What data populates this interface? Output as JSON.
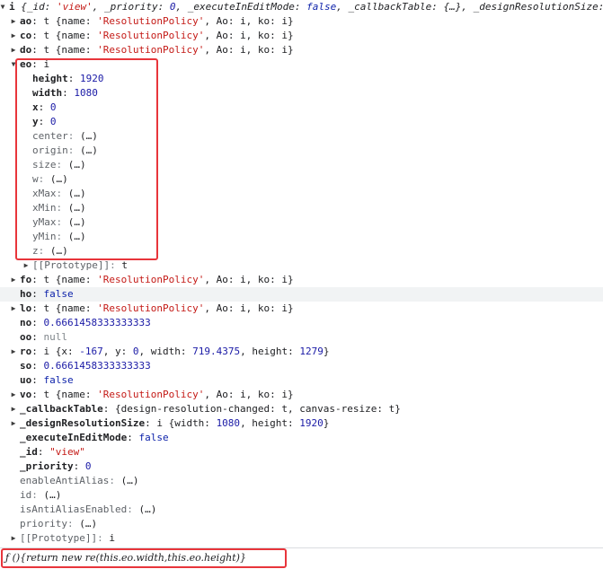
{
  "rows": [
    {
      "indent": 1,
      "arrow": "▾",
      "key": "i",
      "style": "bold",
      "rest": [
        {
          "t": "{_id: ",
          "c": "it"
        },
        {
          "t": "'view'",
          "c": "str it"
        },
        {
          "t": ", _priority: ",
          "c": "it"
        },
        {
          "t": "0",
          "c": "num it"
        },
        {
          "t": ", _executeInEditMode: ",
          "c": "it"
        },
        {
          "t": "false",
          "c": "bool it"
        },
        {
          "t": ", _callbackTable: {…}, _designResolutionSize: i, …}",
          "c": "it"
        }
      ],
      "raw_key_sep": " "
    },
    {
      "indent": 2,
      "arrow": "▸",
      "key": "ao",
      "style": "bold",
      "rest": [
        {
          "t": "t  {name: ",
          "c": ""
        },
        {
          "t": "'ResolutionPolicy'",
          "c": "str"
        },
        {
          "t": ", Ao: i, ko: i}",
          "c": ""
        }
      ]
    },
    {
      "indent": 2,
      "arrow": "▸",
      "key": "co",
      "style": "bold",
      "rest": [
        {
          "t": "t  {name: ",
          "c": ""
        },
        {
          "t": "'ResolutionPolicy'",
          "c": "str"
        },
        {
          "t": ", Ao: i, ko: i}",
          "c": ""
        }
      ]
    },
    {
      "indent": 2,
      "arrow": "▸",
      "key": "do",
      "style": "bold",
      "rest": [
        {
          "t": "t  {name: ",
          "c": ""
        },
        {
          "t": "'ResolutionPolicy'",
          "c": "str"
        },
        {
          "t": ", Ao: i, ko: i}",
          "c": ""
        }
      ]
    },
    {
      "indent": 2,
      "arrow": "▾",
      "key": "eo",
      "style": "bold",
      "rest": [
        {
          "t": "i",
          "c": ""
        }
      ]
    },
    {
      "indent": 3,
      "arrow": "",
      "key": "height",
      "style": "bold",
      "rest": [
        {
          "t": "1920",
          "c": "num"
        }
      ]
    },
    {
      "indent": 3,
      "arrow": "",
      "key": "width",
      "style": "bold",
      "rest": [
        {
          "t": "1080",
          "c": "num"
        }
      ]
    },
    {
      "indent": 3,
      "arrow": "",
      "key": "x",
      "style": "bold",
      "rest": [
        {
          "t": "0",
          "c": "num"
        }
      ]
    },
    {
      "indent": 3,
      "arrow": "",
      "key": "y",
      "style": "bold",
      "rest": [
        {
          "t": "0",
          "c": "num"
        }
      ]
    },
    {
      "indent": 3,
      "arrow": "",
      "key": "center",
      "style": "dim",
      "rest": [
        {
          "t": "(…)",
          "c": ""
        }
      ]
    },
    {
      "indent": 3,
      "arrow": "",
      "key": "origin",
      "style": "dim",
      "rest": [
        {
          "t": "(…)",
          "c": ""
        }
      ]
    },
    {
      "indent": 3,
      "arrow": "",
      "key": "size",
      "style": "dim",
      "rest": [
        {
          "t": "(…)",
          "c": ""
        }
      ]
    },
    {
      "indent": 3,
      "arrow": "",
      "key": "w",
      "style": "dim",
      "rest": [
        {
          "t": "(…)",
          "c": ""
        }
      ]
    },
    {
      "indent": 3,
      "arrow": "",
      "key": "xMax",
      "style": "dim",
      "rest": [
        {
          "t": "(…)",
          "c": ""
        }
      ]
    },
    {
      "indent": 3,
      "arrow": "",
      "key": "xMin",
      "style": "dim",
      "rest": [
        {
          "t": "(…)",
          "c": ""
        }
      ]
    },
    {
      "indent": 3,
      "arrow": "",
      "key": "yMax",
      "style": "dim",
      "rest": [
        {
          "t": "(…)",
          "c": ""
        }
      ]
    },
    {
      "indent": 3,
      "arrow": "",
      "key": "yMin",
      "style": "dim",
      "rest": [
        {
          "t": "(…)",
          "c": ""
        }
      ]
    },
    {
      "indent": 3,
      "arrow": "",
      "key": "z",
      "style": "dim",
      "rest": [
        {
          "t": "(…)",
          "c": ""
        }
      ]
    },
    {
      "indent": 3,
      "arrow": "▸",
      "key": "[[Prototype]]",
      "style": "dim",
      "rest": [
        {
          "t": "t",
          "c": ""
        }
      ]
    },
    {
      "indent": 2,
      "arrow": "▸",
      "key": "fo",
      "style": "bold",
      "rest": [
        {
          "t": "t  {name: ",
          "c": ""
        },
        {
          "t": "'ResolutionPolicy'",
          "c": "str"
        },
        {
          "t": ", Ao: i, ko: i}",
          "c": ""
        }
      ]
    },
    {
      "indent": 2,
      "arrow": "",
      "key": "ho",
      "style": "bold",
      "rest": [
        {
          "t": "false",
          "c": "bool"
        }
      ],
      "highlight": true
    },
    {
      "indent": 2,
      "arrow": "▸",
      "key": "lo",
      "style": "bold",
      "rest": [
        {
          "t": "t  {name: ",
          "c": ""
        },
        {
          "t": "'ResolutionPolicy'",
          "c": "str"
        },
        {
          "t": ", Ao: i, ko: i}",
          "c": ""
        }
      ]
    },
    {
      "indent": 2,
      "arrow": "",
      "key": "no",
      "style": "bold",
      "rest": [
        {
          "t": "0.6661458333333333",
          "c": "num"
        }
      ]
    },
    {
      "indent": 2,
      "arrow": "",
      "key": "oo",
      "style": "bold",
      "rest": [
        {
          "t": "null",
          "c": "nul"
        }
      ]
    },
    {
      "indent": 2,
      "arrow": "▸",
      "key": "ro",
      "style": "bold",
      "rest": [
        {
          "t": "i  {x: ",
          "c": ""
        },
        {
          "t": "-167",
          "c": "num"
        },
        {
          "t": ", y: ",
          "c": ""
        },
        {
          "t": "0",
          "c": "num"
        },
        {
          "t": ", width: ",
          "c": ""
        },
        {
          "t": "719.4375",
          "c": "num"
        },
        {
          "t": ", height: ",
          "c": ""
        },
        {
          "t": "1279",
          "c": "num"
        },
        {
          "t": "}",
          "c": ""
        }
      ]
    },
    {
      "indent": 2,
      "arrow": "",
      "key": "so",
      "style": "bold",
      "rest": [
        {
          "t": "0.6661458333333333",
          "c": "num"
        }
      ]
    },
    {
      "indent": 2,
      "arrow": "",
      "key": "uo",
      "style": "bold",
      "rest": [
        {
          "t": "false",
          "c": "bool"
        }
      ]
    },
    {
      "indent": 2,
      "arrow": "▸",
      "key": "vo",
      "style": "bold",
      "rest": [
        {
          "t": "t  {name: ",
          "c": ""
        },
        {
          "t": "'ResolutionPolicy'",
          "c": "str"
        },
        {
          "t": ", Ao: i, ko: i}",
          "c": ""
        }
      ]
    },
    {
      "indent": 2,
      "arrow": "▸",
      "key": "_callbackTable",
      "style": "bold",
      "rest": [
        {
          "t": "{design-resolution-changed: t, canvas-resize: t}",
          "c": ""
        }
      ]
    },
    {
      "indent": 2,
      "arrow": "▸",
      "key": "_designResolutionSize",
      "style": "bold",
      "rest": [
        {
          "t": "i  {width: ",
          "c": ""
        },
        {
          "t": "1080",
          "c": "num"
        },
        {
          "t": ", height: ",
          "c": ""
        },
        {
          "t": "1920",
          "c": "num"
        },
        {
          "t": "}",
          "c": ""
        }
      ]
    },
    {
      "indent": 2,
      "arrow": "",
      "key": "_executeInEditMode",
      "style": "bold",
      "rest": [
        {
          "t": "false",
          "c": "bool"
        }
      ]
    },
    {
      "indent": 2,
      "arrow": "",
      "key": "_id",
      "style": "bold",
      "rest": [
        {
          "t": "\"view\"",
          "c": "str"
        }
      ]
    },
    {
      "indent": 2,
      "arrow": "",
      "key": "_priority",
      "style": "bold",
      "rest": [
        {
          "t": "0",
          "c": "num"
        }
      ]
    },
    {
      "indent": 2,
      "arrow": "",
      "key": "enableAntiAlias",
      "style": "dim",
      "rest": [
        {
          "t": "(…)",
          "c": ""
        }
      ]
    },
    {
      "indent": 2,
      "arrow": "",
      "key": "id",
      "style": "dim",
      "rest": [
        {
          "t": "(…)",
          "c": ""
        }
      ]
    },
    {
      "indent": 2,
      "arrow": "",
      "key": "isAntiAliasEnabled",
      "style": "dim",
      "rest": [
        {
          "t": "(…)",
          "c": ""
        }
      ]
    },
    {
      "indent": 2,
      "arrow": "",
      "key": "priority",
      "style": "dim",
      "rest": [
        {
          "t": "(…)",
          "c": ""
        }
      ]
    },
    {
      "indent": 2,
      "arrow": "▸",
      "key": "[[Prototype]]",
      "style": "dim",
      "rest": [
        {
          "t": "i",
          "c": ""
        }
      ]
    }
  ],
  "bottom": {
    "expression": "ƒ (){return new re(this.eo.width,this.eo.height)}"
  },
  "colors": {
    "highlight_box": "#e8353b",
    "string": "#c41a16",
    "number": "#1a1aa6"
  }
}
